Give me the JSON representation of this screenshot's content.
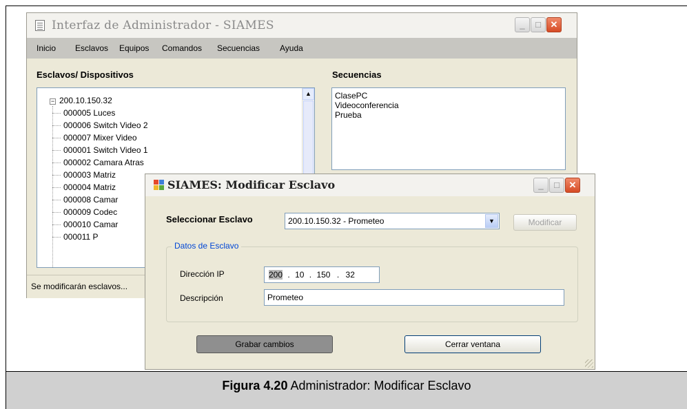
{
  "main_window": {
    "title": "Interfaz de Administrador - SIAMES",
    "menu": [
      "Inicio",
      "Esclavos",
      "Equipos",
      "Comandos",
      "Secuencias",
      "Ayuda"
    ],
    "devices_label": "Esclavos/ Dispositivos",
    "sequences_label": "Secuencias",
    "tree": {
      "root": "200.10.150.32",
      "children": [
        "000005 Luces",
        "000006 Switch Video 2",
        "000007 Mixer Video",
        "000001 Switch Video 1",
        "000002 Camara Atras",
        "000003 Matriz",
        "000004 Matriz",
        "000008 Camar",
        "000009 Codec",
        "000010 Camar",
        "000011 P"
      ]
    },
    "sequences": [
      "ClasePC",
      "Videoconferencia",
      "Prueba"
    ],
    "status": "Se modificarán esclavos..."
  },
  "dialog": {
    "title": "SIAMES: Modificar Esclavo",
    "select_label": "Seleccionar Esclavo",
    "select_value": "200.10.150.32 - Prometeo",
    "modify_button": "Modificar",
    "group_title": "Datos de Esclavo",
    "ip_label": "Dirección IP",
    "ip": [
      "200",
      "10",
      "150",
      "32"
    ],
    "desc_label": "Descripción",
    "desc_value": "Prometeo",
    "save_button": "Grabar cambios",
    "close_button": "Cerrar ventana"
  },
  "caption": {
    "bold": "Figura 4.20",
    "text": " Administrador: Modificar Esclavo"
  },
  "colors": {
    "window_bg": "#ece9d8",
    "menubar_bg": "#c7c6c1",
    "caption_bg": "#d0d0d0",
    "close_button": "#d64b25",
    "group_legend": "#0046d5"
  }
}
